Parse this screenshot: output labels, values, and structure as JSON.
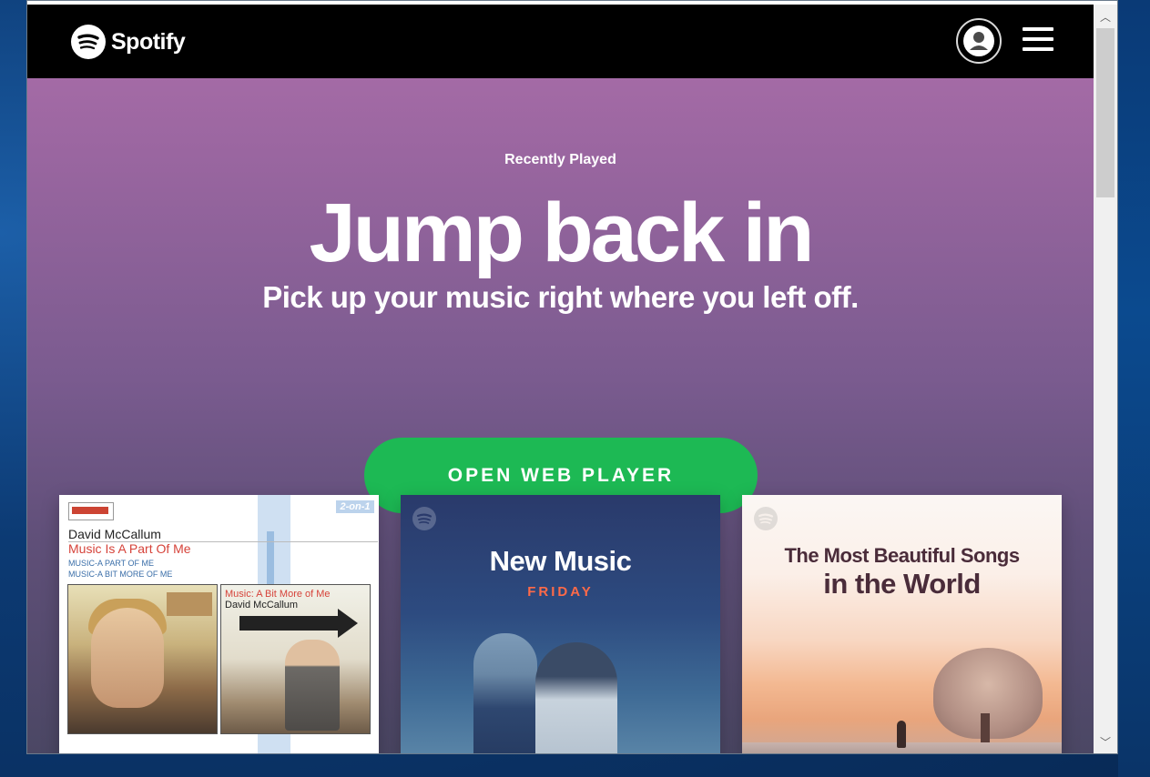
{
  "header": {
    "brand_name": "Spotify",
    "brand_mark": "spotify-logo-icon",
    "account_icon": "user-avatar-icon",
    "menu_icon": "hamburger-menu-icon"
  },
  "hero": {
    "eyebrow": "Recently Played",
    "headline": "Jump back in",
    "subhead": "Pick up your music right where you left off.",
    "cta_label": "OPEN WEB PLAYER"
  },
  "cards": [
    {
      "badge": "2-on-1",
      "artist": "David McCallum",
      "title": "Music Is A Part Of Me",
      "sub1": "MUSIC-A PART OF ME",
      "sub2": "MUSIC-A BIT MORE OF ME",
      "cover2_title": "Music: A Bit More of Me",
      "cover2_artist": "David McCallum"
    },
    {
      "title": "New Music",
      "subtitle": "FRIDAY"
    },
    {
      "title_line1": "The Most Beautiful Songs",
      "title_line2": "in the World"
    }
  ],
  "scrollbar": {
    "up_glyph": "︿",
    "down_glyph": "﹀"
  },
  "colors": {
    "accent_green": "#1db954",
    "topbar_bg": "#000000",
    "hero_top": "#ad6fab",
    "hero_bottom": "#4b4764",
    "friday_color": "#ff6a48"
  }
}
